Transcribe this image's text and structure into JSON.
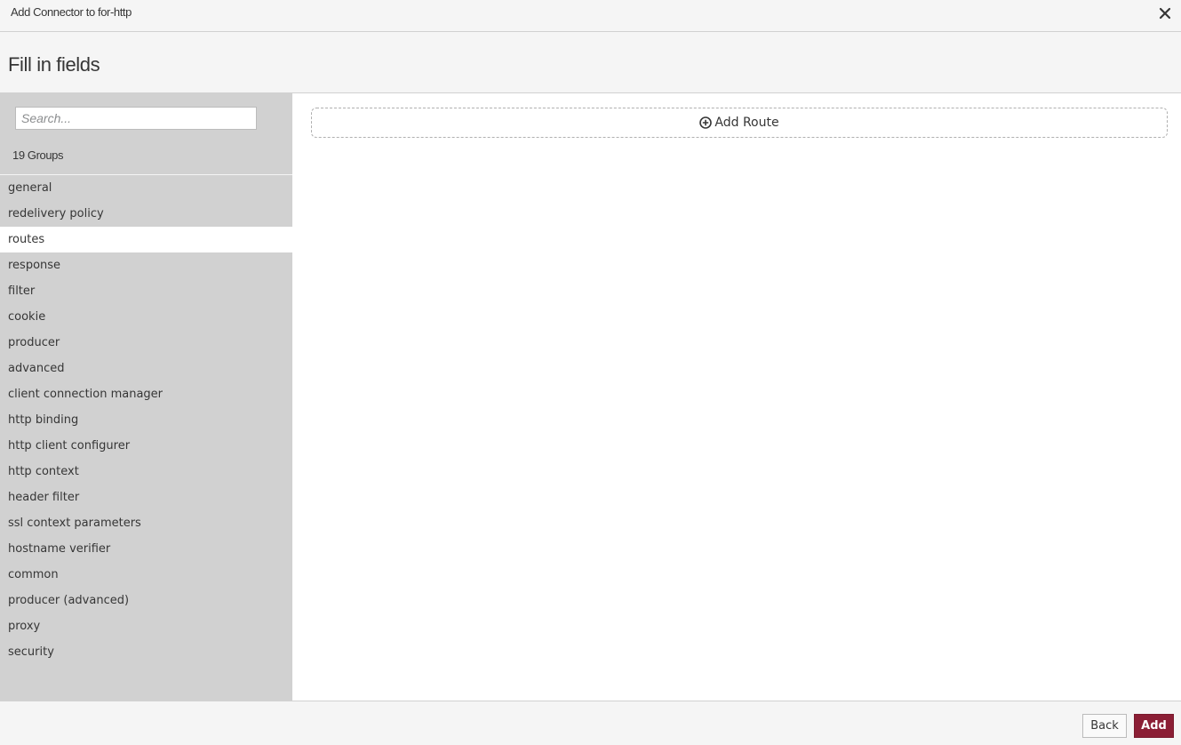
{
  "dialog": {
    "title": "Add Connector to for-http",
    "close_icon": "close-icon"
  },
  "header": {
    "heading": "Fill in fields"
  },
  "sidebar": {
    "search_placeholder": "Search...",
    "groups_count": "19 Groups",
    "groups": [
      {
        "label": "general"
      },
      {
        "label": "redelivery policy"
      },
      {
        "label": "routes",
        "active": true
      },
      {
        "label": "response"
      },
      {
        "label": "filter"
      },
      {
        "label": "cookie"
      },
      {
        "label": "producer"
      },
      {
        "label": "advanced"
      },
      {
        "label": "client connection manager"
      },
      {
        "label": "http binding"
      },
      {
        "label": "http client configurer"
      },
      {
        "label": "http context"
      },
      {
        "label": "header filter"
      },
      {
        "label": "ssl context parameters"
      },
      {
        "label": "hostname verifier"
      },
      {
        "label": "common"
      },
      {
        "label": "producer (advanced)"
      },
      {
        "label": "proxy"
      },
      {
        "label": "security"
      }
    ]
  },
  "main": {
    "add_route_label": "Add Route",
    "add_route_icon": "plus-circle-icon"
  },
  "footer": {
    "back_label": "Back",
    "add_label": "Add"
  },
  "colors": {
    "accent": "#8b1e35",
    "sidebar_bg": "#d1d1d1",
    "header_bg": "#f5f5f5"
  }
}
